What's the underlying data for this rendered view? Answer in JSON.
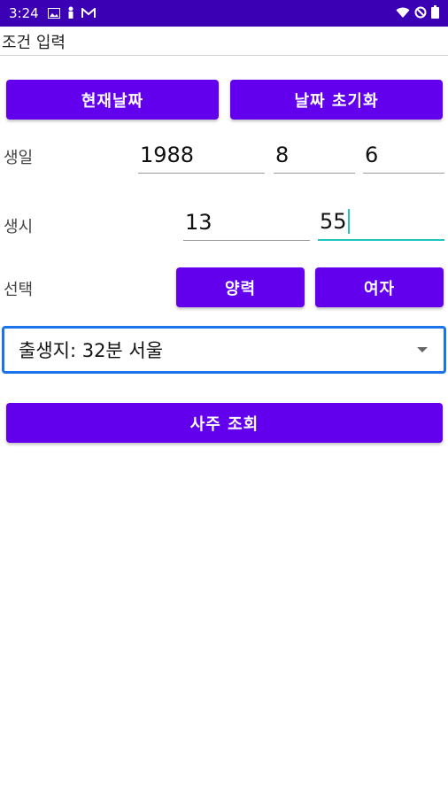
{
  "status_bar": {
    "time": "3:24",
    "left_icons": [
      "image-icon",
      "person-icon",
      "gmail-icon"
    ],
    "right_icons": [
      "wifi-icon",
      "dnd-icon",
      "battery-icon"
    ]
  },
  "page": {
    "title": "조건 입력"
  },
  "buttons": {
    "current_date": "현재날짜",
    "reset_date": "날짜 초기화",
    "calendar": "양력",
    "gender": "여자",
    "lookup": "사주 조회"
  },
  "birthday": {
    "label": "생일",
    "year": "1988",
    "month": "8",
    "day": "6"
  },
  "birthtime": {
    "label": "생시",
    "hour": "13",
    "minute": "55"
  },
  "selection": {
    "label": "선택"
  },
  "birthplace": {
    "selected": "출생지: 32분 서울"
  },
  "colors": {
    "status_bar": "#3c00b4",
    "primary": "#6200ee",
    "focus": "#1a73e8",
    "cursor": "#20c5c0"
  }
}
